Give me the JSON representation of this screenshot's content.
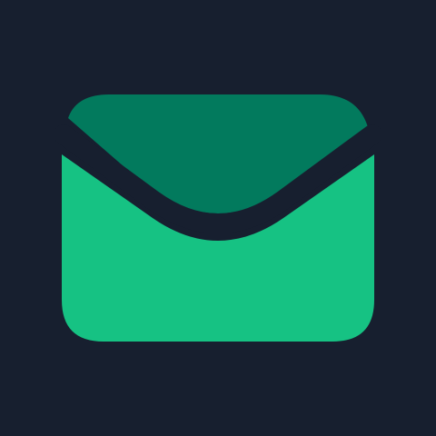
{
  "icon": {
    "name": "mail-envelope-icon"
  },
  "colors": {
    "background": "#171f2f",
    "envelope_body": "#16c283",
    "envelope_flap": "#027a5d",
    "separator": "#171f2f"
  }
}
